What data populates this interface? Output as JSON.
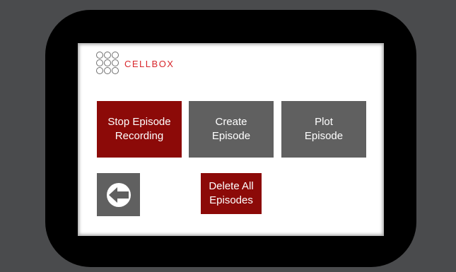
{
  "logo": {
    "text": "CELLBOX",
    "icon": "cellbox-logo-icon",
    "brand_color": "#d8262b"
  },
  "buttons": {
    "stop_episode_recording": "Stop Episode\nRecording",
    "create_episode": "Create\nEpisode",
    "plot_episode": "Plot\nEpisode",
    "delete_all_episodes": "Delete All\nEpisodes",
    "back_icon": "back-arrow-icon"
  },
  "colors": {
    "accent_red": "#8c0a08",
    "button_gray": "#606060",
    "bezel": "#000000",
    "background": "#4a4b4d"
  }
}
